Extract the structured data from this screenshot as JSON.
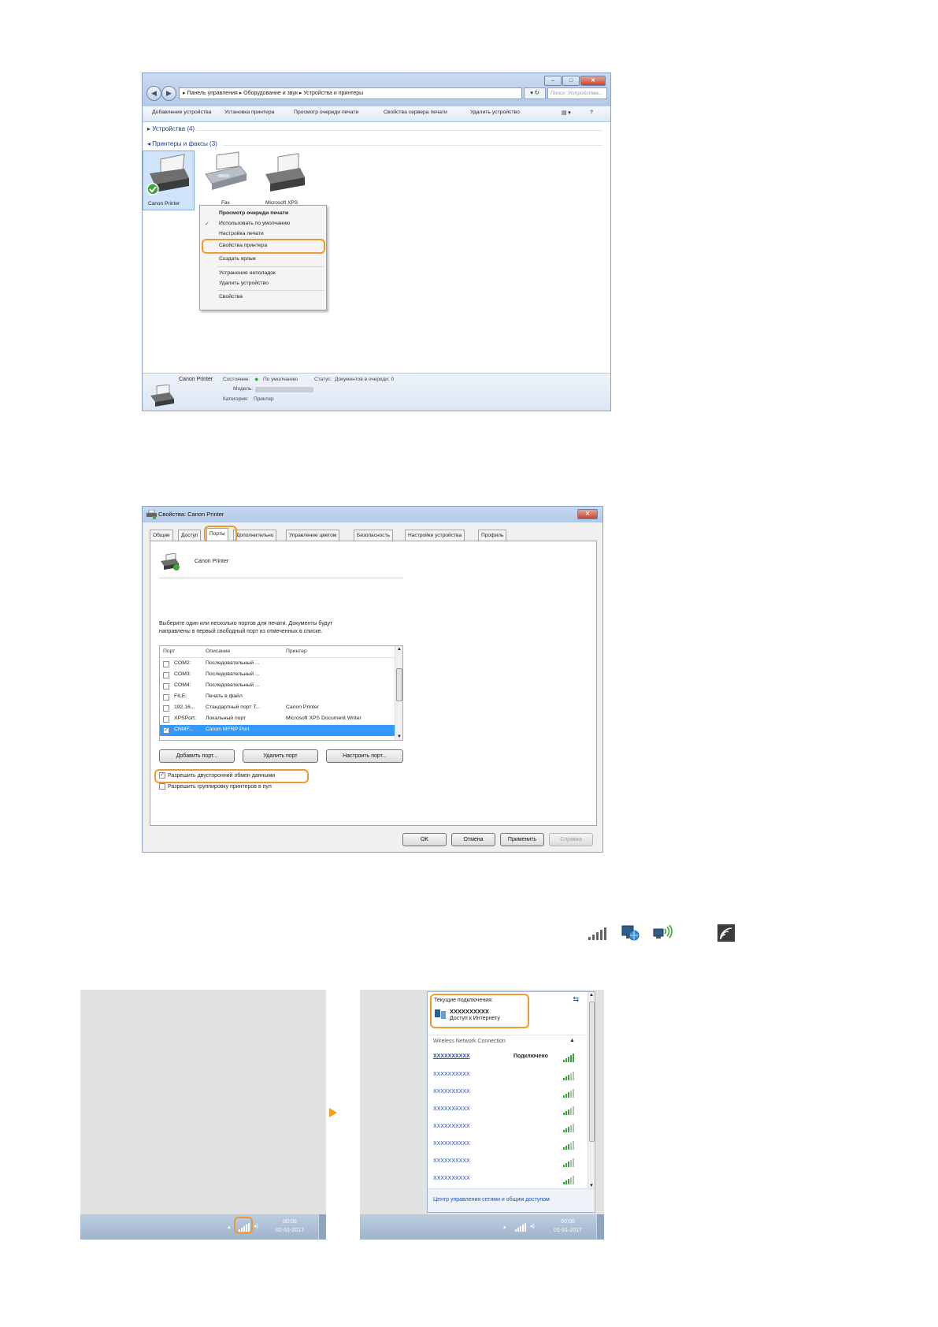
{
  "explorer": {
    "breadcrumb": "▸ Панель управления ▸ Оборудование и звук ▸ Устройства и принтеры",
    "search_placeholder": "Поиск: Устройства...",
    "toolbar": [
      "Добавление устройства",
      "Установка принтера",
      "Просмотр очереди печати",
      "Свойства сервера печати",
      "Удалить устройство"
    ],
    "group_devices": "▸ Устройства (4)",
    "group_printers": "◂ Принтеры и факсы (3)",
    "devices": [
      {
        "label": "Canon Printer"
      },
      {
        "label": "Fax"
      },
      {
        "label": "Microsoft XPS"
      }
    ],
    "context_menu": {
      "items": [
        {
          "label": "Просмотр очереди печати",
          "bold": true
        },
        {
          "label": "Использовать по умолчанию",
          "checked": true
        },
        {
          "label": "Настройка печати"
        },
        {
          "label": "Свойства принтера",
          "highlight": true
        },
        {
          "label": "Создать ярлык"
        },
        {
          "label": "Устранение неполадок"
        },
        {
          "label": "Удалить устройство"
        },
        {
          "label": "Свойства"
        }
      ]
    },
    "status": {
      "name": "Canon Printer",
      "state_label": "Состояние:",
      "state_value": "По умолчанию",
      "status_label": "Статус:",
      "status_value": "Документов в очереди: 0",
      "model_label": "Модель:",
      "category_label": "Категория:",
      "category_value": "Принтер"
    }
  },
  "properties": {
    "title": "Свойства: Canon Printer",
    "tabs": [
      "Общие",
      "Доступ",
      "Порты",
      "Дополнительно",
      "Управление цветом",
      "Безопасность",
      "Настройки устройства",
      "Профиль"
    ],
    "active_tab": "Порты",
    "printer_name": "Canon Printer",
    "instructions_line1": "Выберите один или несколько портов для печати. Документы будут",
    "instructions_line2": "направлены в первый свободный порт из отмеченных в списке.",
    "columns": [
      "Порт",
      "Описание",
      "Принтер"
    ],
    "ports": [
      {
        "port": "COM2:",
        "desc": "Последовательный ...",
        "printer": "",
        "checked": false
      },
      {
        "port": "COM3:",
        "desc": "Последовательный ...",
        "printer": "",
        "checked": false
      },
      {
        "port": "COM4:",
        "desc": "Последовательный ...",
        "printer": "",
        "checked": false
      },
      {
        "port": "FILE:",
        "desc": "Печать в файл",
        "printer": "",
        "checked": false
      },
      {
        "port": "192.16...",
        "desc": "Стандартный порт T...",
        "printer": "Canon Printer",
        "checked": false
      },
      {
        "port": "XPSPort:",
        "desc": "Локальный порт",
        "printer": "Microsoft XPS Document Writer",
        "checked": false
      },
      {
        "port": "CNMF...",
        "desc": "Canon MFNP Port",
        "printer": "",
        "checked": true,
        "selected": true
      }
    ],
    "buttons": {
      "add": "Добавить порт...",
      "delete": "Удалить порт",
      "configure": "Настроить порт..."
    },
    "bidirectional": "Разрешить двусторонний обмен данными",
    "pooling": "Разрешить группировку принтеров в пул",
    "footer": {
      "ok": "OK",
      "cancel": "Отмена",
      "apply": "Применить",
      "help": "Справка"
    }
  },
  "taskbar": {
    "time": "00:00",
    "date": "01-01-2017"
  },
  "network": {
    "current_label": "Текущие подключения:",
    "current_name": "XXXXXXXXXX",
    "current_status": "Доступ к Интернету",
    "section": "Wireless Network Connection",
    "networks": [
      {
        "name": "XXXXXXXXXX",
        "status": "Подключено",
        "connected": true
      },
      {
        "name": "XXXXXXXXXX",
        "status": ""
      },
      {
        "name": "XXXXXXXXXX",
        "status": ""
      },
      {
        "name": "XXXXXXXXXX",
        "status": ""
      },
      {
        "name": "XXXXXXXXXX",
        "status": ""
      },
      {
        "name": "XXXXXXXXXX",
        "status": ""
      },
      {
        "name": "XXXXXXXXXX",
        "status": ""
      },
      {
        "name": "XXXXXXXXXX",
        "status": ""
      }
    ],
    "footer_link": "Центр управления сетями и общим доступом"
  },
  "colors": {
    "highlight": "#ef9a2f",
    "link": "#1f4fb5",
    "selection": "#3399ff"
  }
}
